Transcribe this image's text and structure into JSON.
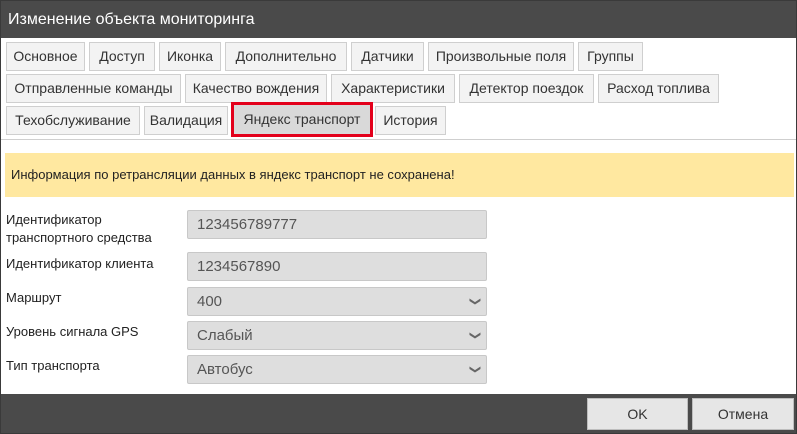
{
  "window": {
    "title": "Изменение объекта мониторинга"
  },
  "tabs": [
    {
      "label": "Основное"
    },
    {
      "label": "Доступ"
    },
    {
      "label": "Иконка"
    },
    {
      "label": "Дополнительно"
    },
    {
      "label": "Датчики"
    },
    {
      "label": "Произвольные поля"
    },
    {
      "label": "Группы"
    },
    {
      "label": "Отправленные команды"
    },
    {
      "label": "Качество вождения"
    },
    {
      "label": "Характеристики"
    },
    {
      "label": "Детектор поездок"
    },
    {
      "label": "Расход топлива"
    },
    {
      "label": "Техобслуживание"
    },
    {
      "label": "Валидация"
    },
    {
      "label": "Яндекс транспорт",
      "active": true
    },
    {
      "label": "История"
    }
  ],
  "alert": {
    "text": "Информация по ретрансляции данных в яндекс транспорт не сохранена!"
  },
  "form": {
    "vehicle_id": {
      "label_line1": "Идентификатор",
      "label_line2": "транспортного средства",
      "value": "123456789777"
    },
    "client_id": {
      "label": "Идентификатор клиента",
      "value": "1234567890"
    },
    "route": {
      "label": "Маршрут",
      "value": "400"
    },
    "gps_level": {
      "label": "Уровень сигнала GPS",
      "value": "Слабый"
    },
    "transport_type": {
      "label": "Тип транспорта",
      "value": "Автобус"
    }
  },
  "footer": {
    "ok_label": "OK",
    "cancel_label": "Отмена"
  },
  "icons": {
    "dropdown": "chevron-down-icon"
  },
  "colors": {
    "titlebar": "#4a4a4a",
    "alert_bg": "#ffe8a0",
    "active_tab_border": "#e3001b"
  }
}
